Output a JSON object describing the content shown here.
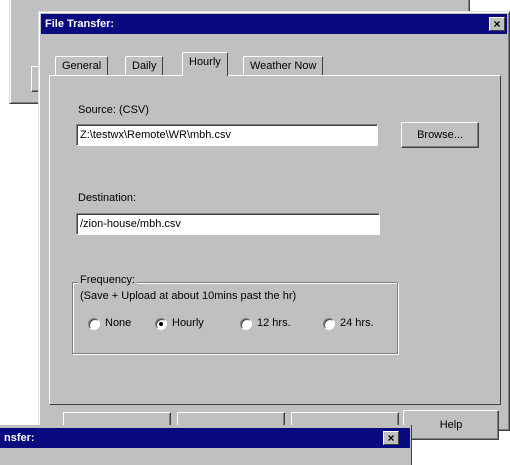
{
  "window": {
    "title": "File Transfer:",
    "close_glyph": "×"
  },
  "tabs": [
    {
      "label": "General",
      "active": false
    },
    {
      "label": "Daily",
      "active": false
    },
    {
      "label": "Hourly",
      "active": true
    },
    {
      "label": "Weather Now",
      "active": false
    }
  ],
  "source": {
    "label": "Source: (CSV)",
    "value": "Z:\\testwx\\Remote\\WR\\mbh.csv",
    "browse_label": "Browse..."
  },
  "destination": {
    "label": "Destination:",
    "value": "/zion-house/mbh.csv"
  },
  "frequency": {
    "legend": "Frequency:",
    "note": "(Save + Upload at about 10mins past the hr)",
    "options": [
      {
        "label": "None",
        "selected": false
      },
      {
        "label": "Hourly",
        "selected": true
      },
      {
        "label": "12 hrs.",
        "selected": false
      },
      {
        "label": "24 hrs.",
        "selected": false
      }
    ]
  },
  "footer": {
    "help_label": "Help"
  },
  "second_window": {
    "title": "nsfer:",
    "close_glyph": "×"
  }
}
